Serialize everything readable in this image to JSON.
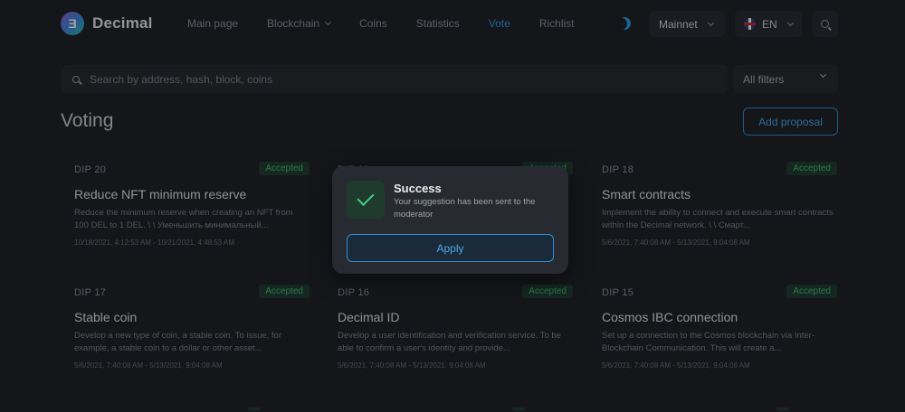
{
  "app": {
    "logo_letter": "Ǝ",
    "logo_text": "Decimal"
  },
  "nav": {
    "items": [
      {
        "label": "Main page"
      },
      {
        "label": "Blockchain"
      },
      {
        "label": "Coins"
      },
      {
        "label": "Statistics"
      },
      {
        "label": "Vote"
      },
      {
        "label": "Richlist"
      }
    ],
    "active": "Vote"
  },
  "header": {
    "network": "Mainnet",
    "language": "EN"
  },
  "search": {
    "placeholder": "Search by address, hash, block, coins",
    "value": "",
    "filters_label": "All filters"
  },
  "page": {
    "title": "Voting",
    "add_button": "Add proposal"
  },
  "cards": [
    {
      "id": "DIP 20",
      "status": "Accepted",
      "title": "Reduce NFT minimum reserve",
      "description": "Reduce the minimum reserve when creating an NFT from 100 DEL to 1 DEL. \\ \\ Уменьшить минимальный...",
      "dates": "10/18/2021, 4:12:53 AM - 10/21/2021, 4:48:53 AM"
    },
    {
      "id": "DIP 19",
      "status": "Accepted",
      "title": "",
      "description": "",
      "dates": ""
    },
    {
      "id": "DIP 18",
      "status": "Accepted",
      "title": "Smart contracts",
      "description": "Implement the ability to connect and execute smart contracts within the Decimal network. \\ \\ Смарт...",
      "dates": "5/6/2021, 7:40:08 AM - 5/13/2021, 9:04:08 AM"
    },
    {
      "id": "DIP 17",
      "status": "Accepted",
      "title": "Stable coin",
      "description": "Develop a new type of coin, a stable coin. To issue, for example, a stable coin to a dollar or other asset...",
      "dates": "5/6/2021, 7:40:08 AM - 5/13/2021, 9:04:08 AM"
    },
    {
      "id": "DIP 16",
      "status": "Accepted",
      "title": "Decimal ID",
      "description": "Develop a user identification and verification service. To be able to confirm a user's identity and provide...",
      "dates": "5/6/2021, 7:40:08 AM - 5/13/2021, 9:04:08 AM"
    },
    {
      "id": "DIP 15",
      "status": "Accepted",
      "title": "Cosmos IBC connection",
      "description": "Set up a connection to the Cosmos blockchain via Inter-Blockchain Communication. This will create a...",
      "dates": "5/6/2021, 7:40:08 AM - 5/13/2021, 9:04:08 AM"
    }
  ],
  "modal": {
    "title": "Success",
    "message": "Your suggestion has been sent to the moderator",
    "button": "Apply"
  },
  "colors": {
    "accent": "#2e9be8",
    "accepted": "#3fbf77",
    "background": "#1c1f24"
  }
}
